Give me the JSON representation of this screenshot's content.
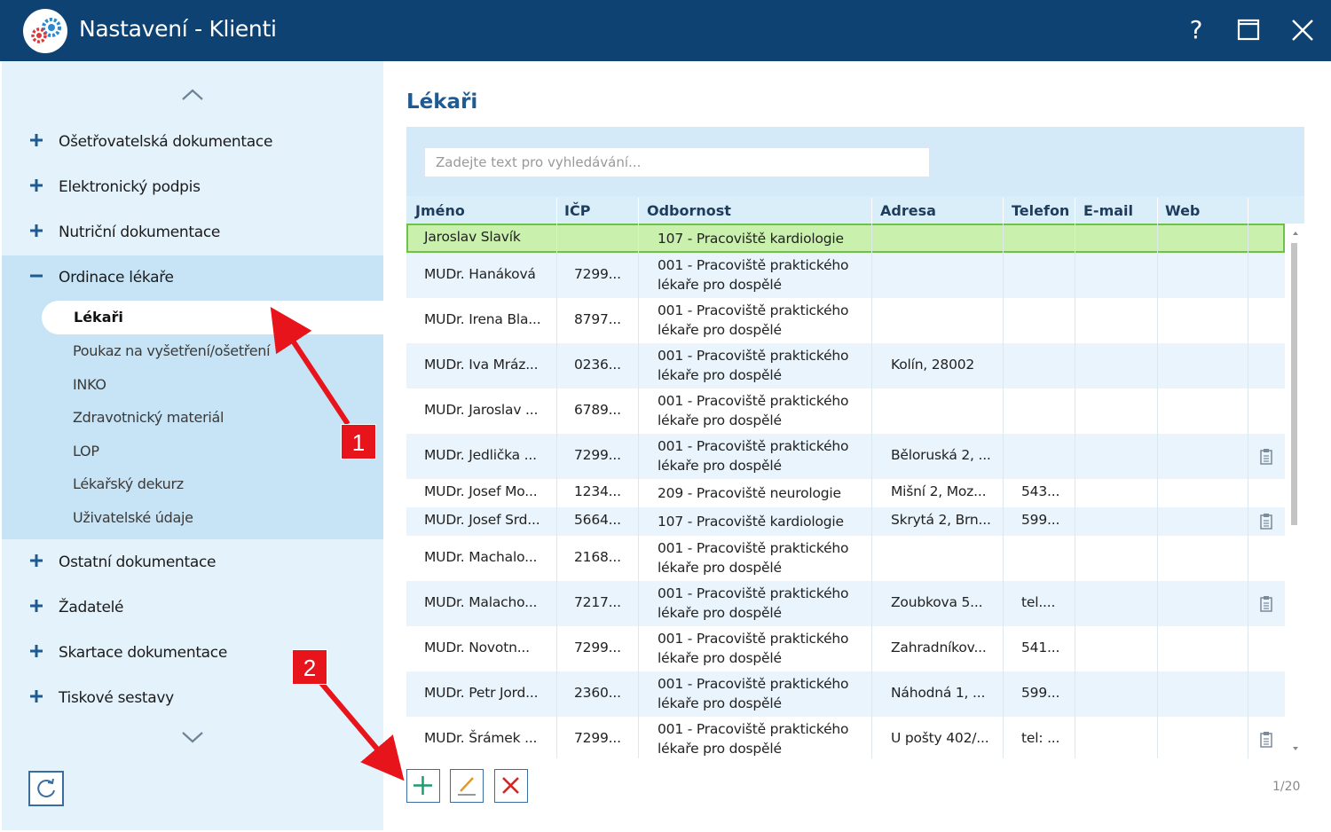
{
  "window": {
    "title": "Nastavení - Klienti",
    "help_label": "?"
  },
  "colors": {
    "titlebar": "#0d4272",
    "sidebar": "#e4f2fb",
    "sidebar_group": "#c6e4f6",
    "accent": "#1f5a92",
    "selected_row": "#c9f0ad",
    "annotation": "#e8141b"
  },
  "sidebar": {
    "items": [
      {
        "label": "Ošetřovatelská dokumentace",
        "expanded": false
      },
      {
        "label": "Elektronický podpis",
        "expanded": false
      },
      {
        "label": "Nutriční dokumentace",
        "expanded": false
      },
      {
        "label": "Ordinace lékaře",
        "expanded": true
      },
      {
        "label": "Ostatní dokumentace",
        "expanded": false
      },
      {
        "label": "Žadatelé",
        "expanded": false
      },
      {
        "label": "Skartace dokumentace",
        "expanded": false
      },
      {
        "label": "Tiskové sestavy",
        "expanded": false
      }
    ],
    "subitems": [
      {
        "label": "Lékaři",
        "active": true
      },
      {
        "label": "Poukaz na vyšetření/ošetření",
        "active": false
      },
      {
        "label": "INKO",
        "active": false
      },
      {
        "label": "Zdravotnický materiál",
        "active": false
      },
      {
        "label": "LOP",
        "active": false
      },
      {
        "label": "Lékařský dekurz",
        "active": false
      },
      {
        "label": "Uživatelské údaje",
        "active": false
      }
    ]
  },
  "main": {
    "title": "Lékaři",
    "search_placeholder": "Zadejte text pro vyhledávání...",
    "columns": [
      "Jméno",
      "IČP",
      "Odbornost",
      "Adresa",
      "Telefon",
      "E-mail",
      "Web"
    ],
    "rows": [
      {
        "jmeno": "Jaroslav Slavík",
        "icp": "",
        "odbornost": "107 - Pracoviště kardiologie",
        "adresa": "",
        "telefon": "",
        "clip": false
      },
      {
        "jmeno": "MUDr. Hanáková",
        "icp": "7299...",
        "odbornost": "001 - Pracoviště praktického lékaře pro dospělé",
        "adresa": "",
        "telefon": "",
        "clip": false
      },
      {
        "jmeno": "MUDr. Irena Bla...",
        "icp": "8797...",
        "odbornost": "001 - Pracoviště praktického lékaře pro dospělé",
        "adresa": "",
        "telefon": "",
        "clip": false
      },
      {
        "jmeno": "MUDr. Iva Mráz...",
        "icp": "0236...",
        "odbornost": "001 - Pracoviště praktického lékaře pro dospělé",
        "adresa": "Kolín, 28002",
        "telefon": "",
        "clip": false
      },
      {
        "jmeno": "MUDr. Jaroslav ...",
        "icp": "6789...",
        "odbornost": "001 - Pracoviště praktického lékaře pro dospělé",
        "adresa": "",
        "telefon": "",
        "clip": false
      },
      {
        "jmeno": "MUDr. Jedlička ...",
        "icp": "7299...",
        "odbornost": "001 - Pracoviště praktického lékaře pro dospělé",
        "adresa": "Běloruská 2, ...",
        "telefon": "",
        "clip": true
      },
      {
        "jmeno": "MUDr. Josef Mo...",
        "icp": "1234...",
        "odbornost": "209 - Pracoviště neurologie",
        "adresa": "Mišní 2, Moz...",
        "telefon": "543...",
        "clip": false
      },
      {
        "jmeno": "MUDr. Josef Srd...",
        "icp": "5664...",
        "odbornost": "107 - Pracoviště kardiologie",
        "adresa": "Skrytá 2, Brn...",
        "telefon": "599...",
        "clip": true
      },
      {
        "jmeno": "MUDr. Machalo...",
        "icp": "2168...",
        "odbornost": "001 - Pracoviště praktického lékaře pro dospělé",
        "adresa": "",
        "telefon": "",
        "clip": false
      },
      {
        "jmeno": "MUDr. Malacho...",
        "icp": "7217...",
        "odbornost": "001 - Pracoviště praktického lékaře pro dospělé",
        "adresa": "Zoubkova 5...",
        "telefon": "tel....",
        "clip": true
      },
      {
        "jmeno": "MUDr. Novotn...",
        "icp": "7299...",
        "odbornost": "001 - Pracoviště praktického lékaře pro dospělé",
        "adresa": "Zahradníkov...",
        "telefon": "541...",
        "clip": false
      },
      {
        "jmeno": "MUDr. Petr Jord...",
        "icp": "2360...",
        "odbornost": "001 - Pracoviště praktického lékaře pro dospělé",
        "adresa": "Náhodná 1, ...",
        "telefon": "599...",
        "clip": false
      },
      {
        "jmeno": "MUDr. Šrámek ...",
        "icp": "7299...",
        "odbornost": "001 - Pracoviště praktického lékaře pro dospělé",
        "adresa": "U pošty 402/...",
        "telefon": "tel: ...",
        "clip": true
      }
    ],
    "page_info": "1/20"
  },
  "annotations": [
    {
      "label": "1"
    },
    {
      "label": "2"
    }
  ]
}
